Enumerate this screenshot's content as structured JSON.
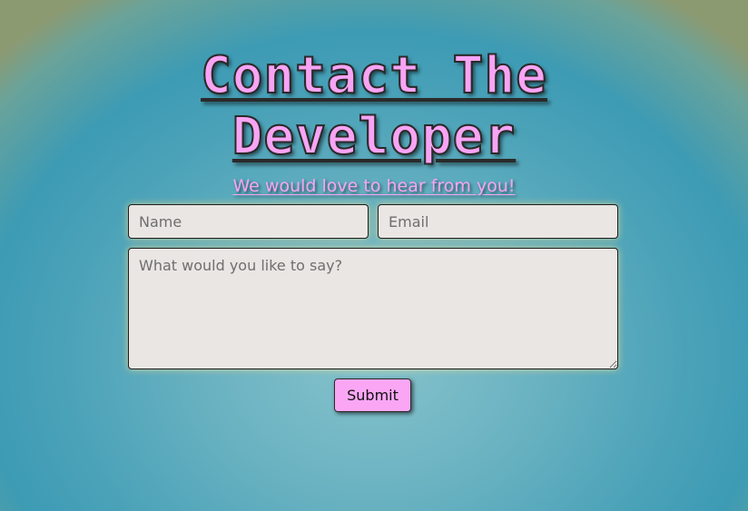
{
  "header": {
    "title_line1": "Contact The",
    "title_line2": "Developer",
    "subtitle": "We would love to hear from you!"
  },
  "form": {
    "name_placeholder": "Name",
    "email_placeholder": "Email",
    "message_placeholder": "What would you like to say?",
    "submit_label": "Submit"
  },
  "colors": {
    "accent_pink": "#f8a4f4",
    "field_background": "#e9e6e3",
    "background_teal": "#4aa2b8"
  }
}
